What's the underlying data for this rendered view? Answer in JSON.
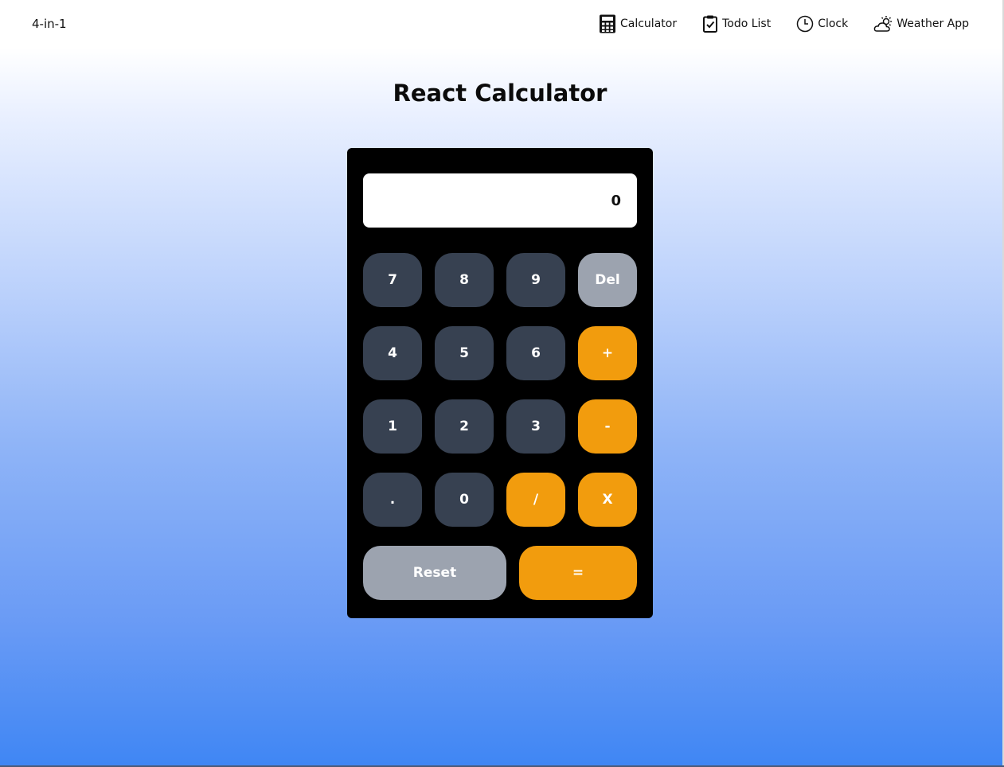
{
  "nav": {
    "brand": "4-in-1",
    "links": [
      {
        "label": "Calculator",
        "icon": "calculator-icon"
      },
      {
        "label": "Todo List",
        "icon": "clipboard-check-icon"
      },
      {
        "label": "Clock",
        "icon": "clock-icon"
      },
      {
        "label": "Weather App",
        "icon": "weather-sun-cloud-icon"
      }
    ]
  },
  "page": {
    "title": "React Calculator"
  },
  "calculator": {
    "display": "0",
    "keys": {
      "k7": "7",
      "k8": "8",
      "k9": "9",
      "del": "Del",
      "k4": "4",
      "k5": "5",
      "k6": "6",
      "plus": "+",
      "k1": "1",
      "k2": "2",
      "k3": "3",
      "minus": "-",
      "dot": ".",
      "k0": "0",
      "divide": "/",
      "multiply": "X",
      "reset": "Reset",
      "equals": "="
    }
  },
  "colors": {
    "number_key": "#374151",
    "function_key": "#9ca3af",
    "operator_key": "#f29c0d",
    "calculator_body": "#000000",
    "gradient_bottom": "#3f86f4"
  }
}
